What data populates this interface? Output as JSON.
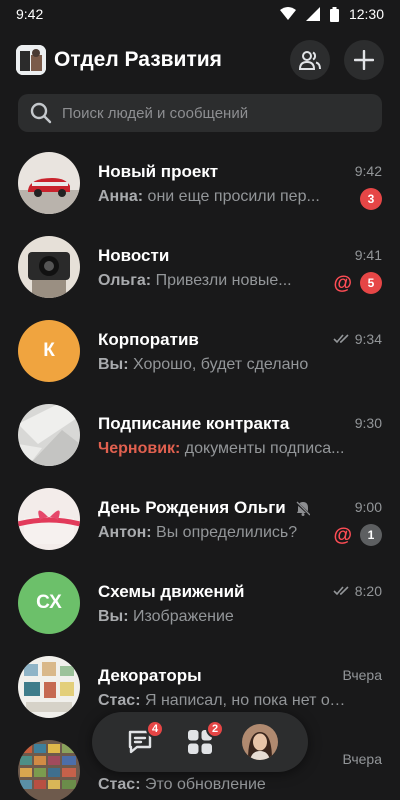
{
  "status_bar": {
    "time_left": "9:42",
    "time_right": "12:30"
  },
  "header": {
    "title": "Отдел Развития"
  },
  "search": {
    "placeholder": "Поиск людей и сообщений"
  },
  "chats": [
    {
      "title": "Новый проект",
      "sender": "Анна:",
      "text": " они еще просили пер...",
      "time": "9:42",
      "badge": "3"
    },
    {
      "title": "Новости",
      "sender": "Ольга:",
      "text": " Привезли новые...",
      "time": "9:41",
      "mention": "@",
      "badge": "5"
    },
    {
      "title": "Корпоратив",
      "initials": "К",
      "sender": "Вы:",
      "text": " Хорошо, будет сделано",
      "time": "9:34"
    },
    {
      "title": "Подписание контракта",
      "sender": "Черновик:",
      "text": " документы подписа...",
      "time": "9:30"
    },
    {
      "title": "День Рождения Ольги",
      "sender": "Антон:",
      "text": " Вы определились?",
      "time": "9:00",
      "mention": "@",
      "badge": "1"
    },
    {
      "title": "Схемы движений",
      "initials": "СХ",
      "sender": "Вы:",
      "text": " Изображение",
      "time": "8:20"
    },
    {
      "title": "Декораторы",
      "sender": "Стас:",
      "text": " Я написал, но пока нет отв...",
      "time": "Вчера"
    },
    {
      "title": "",
      "sender": "Стас:",
      "text": " Это обновление",
      "time": "Вчера"
    }
  ],
  "bottom_nav": {
    "messages_badge": "4",
    "apps_badge": "2"
  },
  "colors": {
    "background": "#19191a",
    "surface": "#2c2d2e",
    "badge_red": "#e64646",
    "draft_red": "#e0604f",
    "avatar_orange": "#f0a43f",
    "avatar_green": "#6cc06a"
  },
  "icons": [
    "wifi-icon",
    "signal-icon",
    "battery-icon",
    "contacts-icon",
    "plus-icon",
    "search-icon",
    "double-check-icon",
    "bell-off-icon",
    "chat-icon",
    "apps-icon"
  ]
}
